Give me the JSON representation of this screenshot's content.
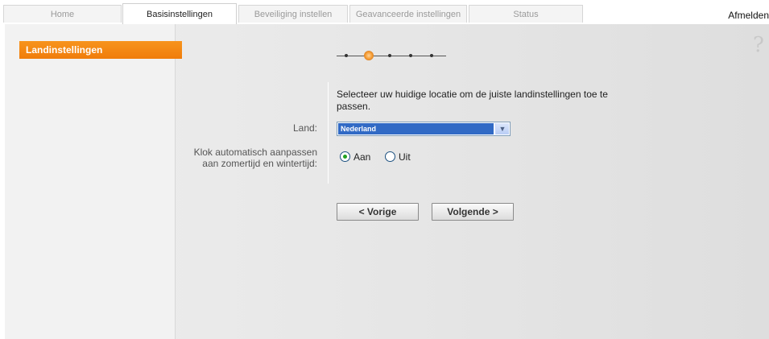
{
  "tabs": {
    "home": "Home",
    "basis": "Basisinstellingen",
    "beveiliging": "Beveiliging instellen",
    "geavanceerd": "Geavanceerde instellingen",
    "status": "Status"
  },
  "logout_label": "Afmelden",
  "sidebar": {
    "items": [
      {
        "label": "Landinstellingen"
      }
    ]
  },
  "help_icon": "?",
  "intro_text": "Selecteer uw huidige locatie om de juiste landinstellingen toe te passen.",
  "form": {
    "land_label": "Land:",
    "land_value": "Nederland",
    "klok_label": "Klok automatisch aanpassen aan zomertijd en wintertijd:",
    "radio_aan": "Aan",
    "radio_uit": "Uit"
  },
  "buttons": {
    "previous": "< Vorige",
    "next": "Volgende >"
  },
  "stepper": {
    "total_steps": 6,
    "current_step": 2
  },
  "colors": {
    "accent": "#f07c0a",
    "select_highlight": "#316ac5"
  }
}
